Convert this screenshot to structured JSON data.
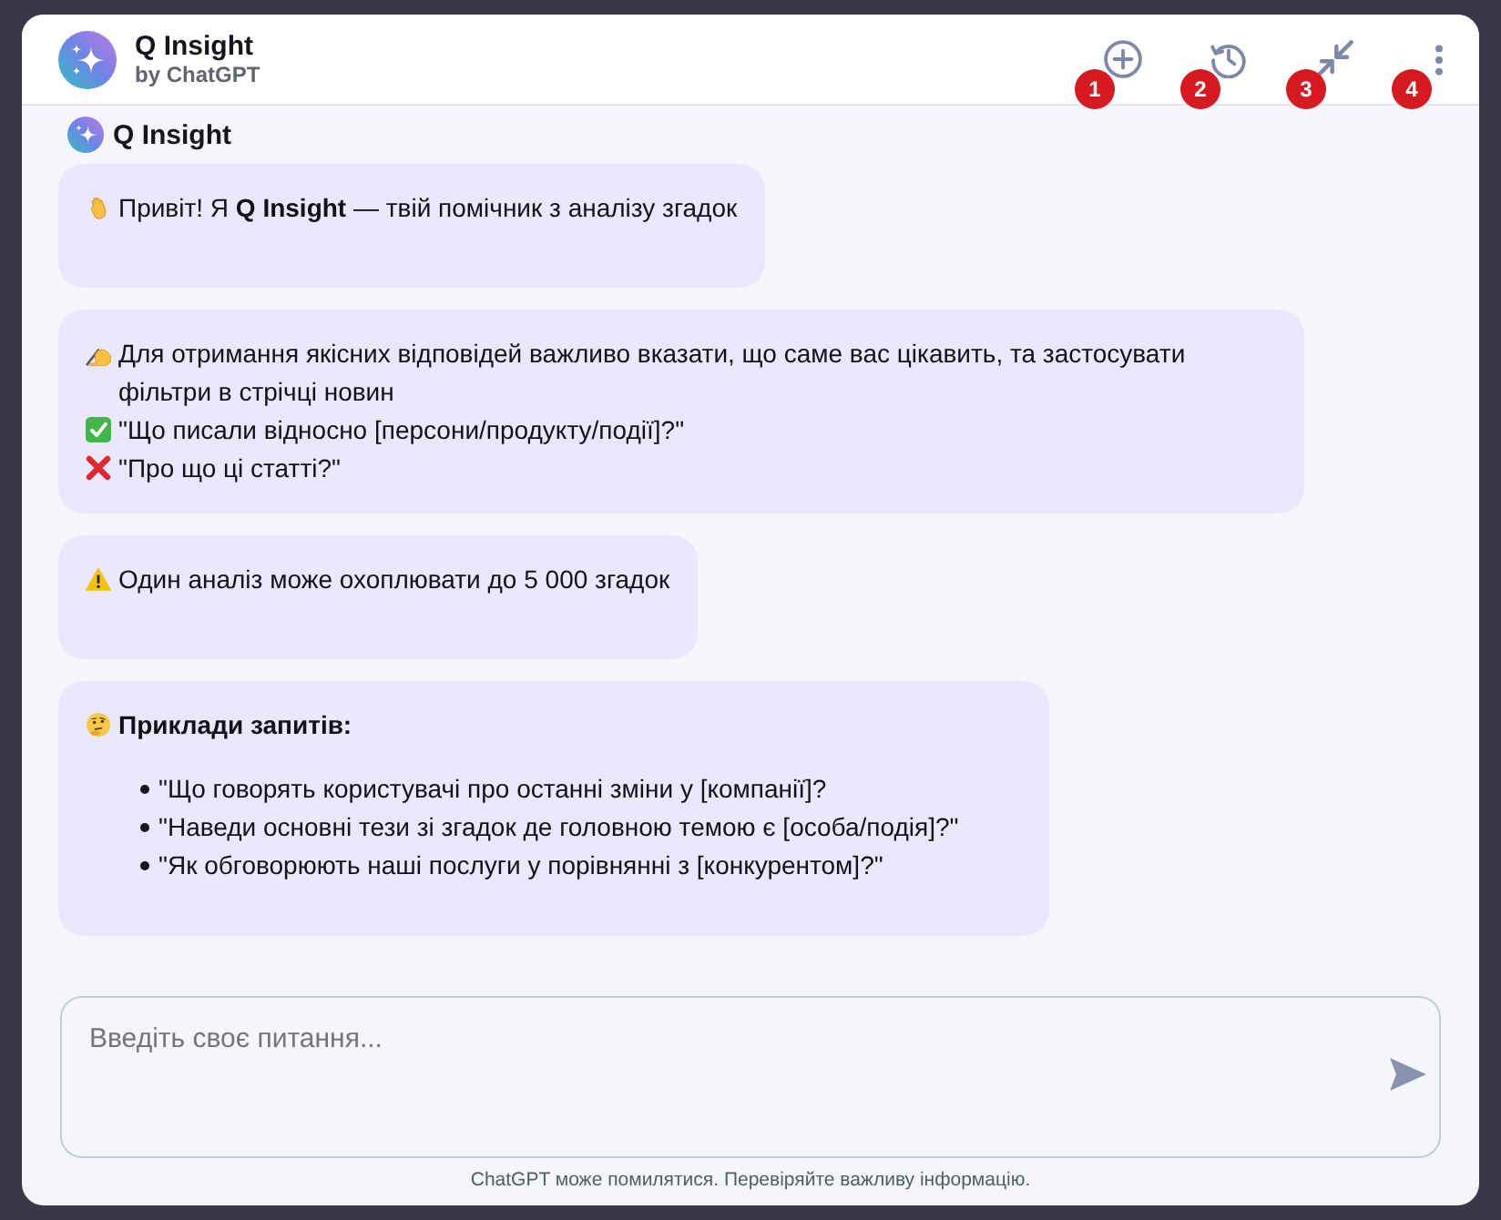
{
  "header": {
    "title": "Q Insight",
    "subtitle": "by ChatGPT",
    "actions": [
      {
        "kind": "new_chat",
        "marker": "1"
      },
      {
        "kind": "history",
        "marker": "2"
      },
      {
        "kind": "collapse",
        "marker": "3"
      },
      {
        "kind": "more",
        "marker": "4"
      }
    ]
  },
  "assistant": {
    "name": "Q Insight"
  },
  "messages": [
    {
      "lines": [
        {
          "kind": "wave",
          "text": "Привіт! Я **Q Insight** — твій помічник з аналізу згадок"
        }
      ]
    },
    {
      "lines": [
        {
          "kind": "writing",
          "text": "Для отримання якісних відповідей важливо вказати, що саме вас цікавить, та застосувати фільтри в стрічці новин"
        },
        {
          "kind": "check",
          "text": "\"Що писали відносно [персони/продукту/події]?\""
        },
        {
          "kind": "cross",
          "text": "\"Про що ці статті?\""
        }
      ]
    },
    {
      "lines": [
        {
          "kind": "warning",
          "text": "Один аналіз може охоплювати до 5 000 згадок"
        }
      ]
    },
    {
      "heading": {
        "kind": "thinking",
        "text": "Приклади запитів:"
      },
      "list": [
        "\"Що говорять користувачі про останні зміни у [компанії]?",
        "\"Наведи основні тези зі згадок де головною темою є [особа/подія]?\"",
        "\"Як обговорюють наші послуги у порівнянні з [конкурентом]?\""
      ]
    }
  ],
  "composer": {
    "placeholder": "Введіть своє питання..."
  },
  "disclaimer": "ChatGPT може помилятися. Перевіряйте важливу інформацію."
}
